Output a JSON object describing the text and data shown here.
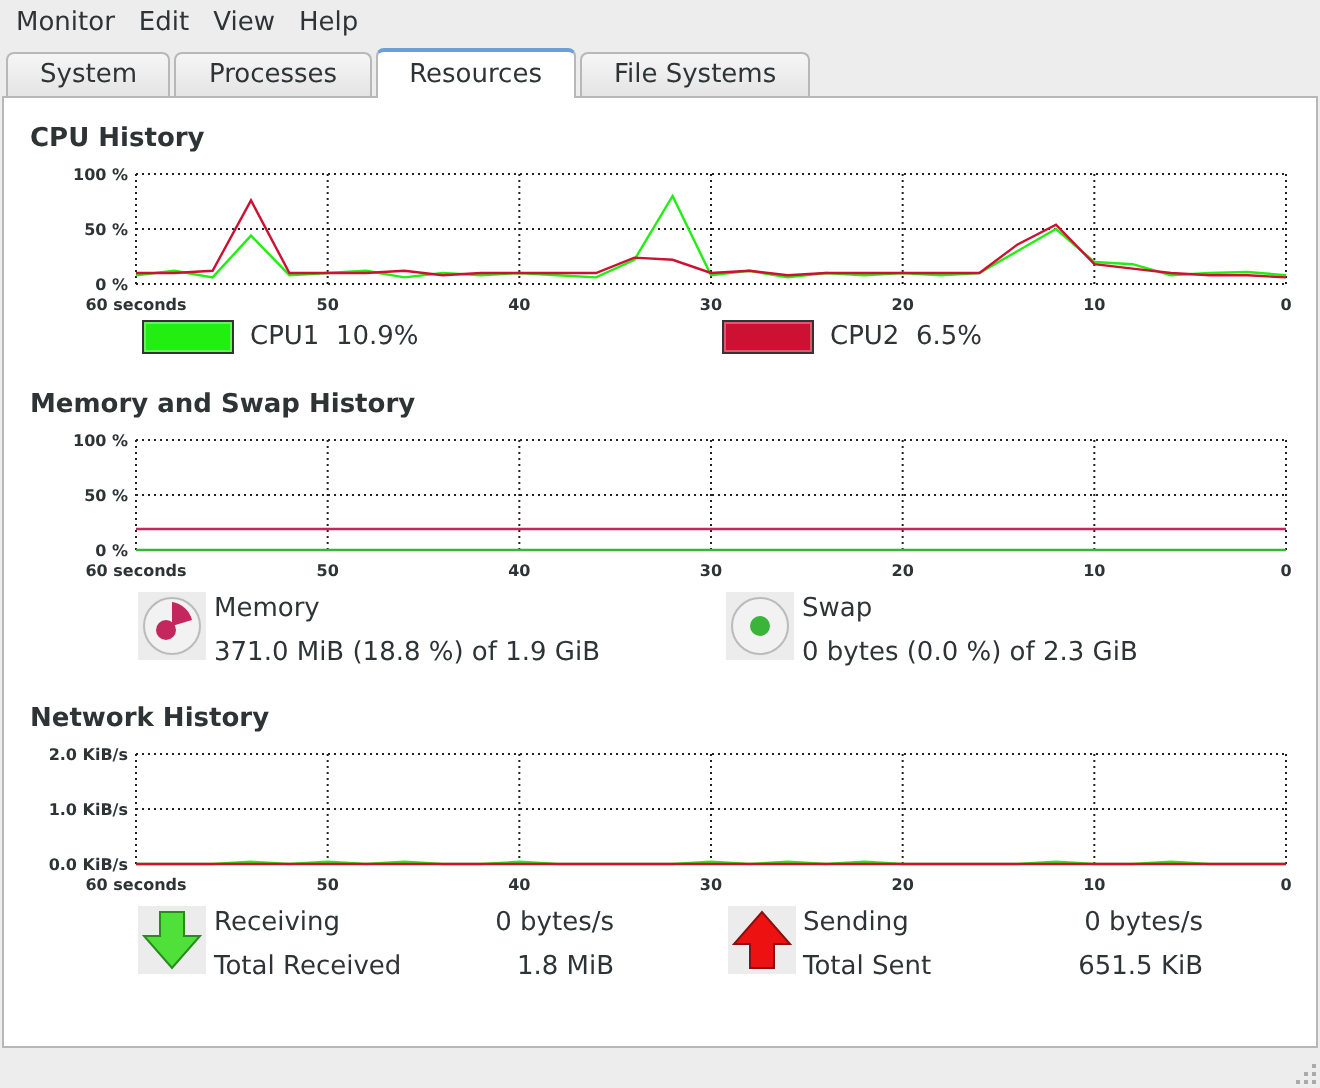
{
  "menu": [
    "Monitor",
    "Edit",
    "View",
    "Help"
  ],
  "tabs": [
    {
      "label": "System",
      "selected": false
    },
    {
      "label": "Processes",
      "selected": false
    },
    {
      "label": "Resources",
      "selected": true
    },
    {
      "label": "File Systems",
      "selected": false
    }
  ],
  "cpu_history": {
    "title": "CPU History",
    "chart_data": {
      "type": "line",
      "grid": true,
      "x": [
        60,
        58,
        56,
        54,
        52,
        50,
        48,
        46,
        44,
        42,
        40,
        38,
        36,
        34,
        32,
        30,
        28,
        26,
        24,
        22,
        20,
        18,
        16,
        14,
        12,
        10,
        8,
        6,
        4,
        2,
        0
      ],
      "xlim": [
        60,
        0
      ],
      "ylim": [
        0,
        100
      ],
      "xticks": [
        {
          "value": 60,
          "label": "60 seconds"
        },
        {
          "value": 50,
          "label": "50"
        },
        {
          "value": 40,
          "label": "40"
        },
        {
          "value": 30,
          "label": "30"
        },
        {
          "value": 20,
          "label": "20"
        },
        {
          "value": 10,
          "label": "10"
        },
        {
          "value": 0,
          "label": "0"
        }
      ],
      "yticks": [
        {
          "value": 100,
          "label": "100 %"
        },
        {
          "value": 50,
          "label": "50 %"
        },
        {
          "value": 0,
          "label": "0 %"
        }
      ],
      "series": [
        {
          "color": "#22ee11",
          "values": [
            8,
            12,
            6,
            44,
            8,
            10,
            12,
            6,
            10,
            8,
            10,
            8,
            6,
            22,
            80,
            8,
            12,
            6,
            10,
            8,
            10,
            8,
            10,
            30,
            50,
            20,
            18,
            8,
            10,
            11,
            8
          ]
        },
        {
          "color": "#cc1133",
          "values": [
            10,
            10,
            12,
            76,
            10,
            10,
            10,
            12,
            8,
            10,
            10,
            10,
            10,
            24,
            22,
            10,
            12,
            8,
            10,
            10,
            10,
            10,
            10,
            36,
            54,
            18,
            14,
            10,
            8,
            8,
            6
          ]
        }
      ]
    },
    "legend": [
      {
        "label": "CPU1",
        "reading": "10.9%",
        "color": "#22ee11"
      },
      {
        "label": "CPU2",
        "reading": "6.5%",
        "color": "#cc1133"
      }
    ]
  },
  "memory_history": {
    "title": "Memory and Swap History",
    "chart_data": {
      "type": "line",
      "grid": true,
      "x": [
        60,
        0
      ],
      "xlim": [
        60,
        0
      ],
      "ylim": [
        0,
        100
      ],
      "xticks": [
        {
          "value": 60,
          "label": "60 seconds"
        },
        {
          "value": 50,
          "label": "50"
        },
        {
          "value": 40,
          "label": "40"
        },
        {
          "value": 30,
          "label": "30"
        },
        {
          "value": 20,
          "label": "20"
        },
        {
          "value": 10,
          "label": "10"
        },
        {
          "value": 0,
          "label": "0"
        }
      ],
      "yticks": [
        {
          "value": 100,
          "label": "100 %"
        },
        {
          "value": 50,
          "label": "50 %"
        },
        {
          "value": 0,
          "label": "0 %"
        }
      ],
      "series": [
        {
          "color": "#c4265e",
          "values": [
            19,
            19
          ]
        },
        {
          "color": "#3ab53a",
          "values": [
            0,
            0
          ]
        }
      ]
    },
    "items": [
      {
        "kind": "memory",
        "label": "Memory",
        "detail": "371.0 MiB (18.8 %) of 1.9 GiB",
        "color": "#c4265e"
      },
      {
        "kind": "swap",
        "label": "Swap",
        "detail": "0 bytes (0.0 %) of 2.3 GiB",
        "color": "#3ab53a"
      }
    ]
  },
  "network_history": {
    "title": "Network History",
    "chart_data": {
      "type": "line",
      "grid": true,
      "x": [
        60,
        58,
        56,
        54,
        52,
        50,
        48,
        46,
        44,
        42,
        40,
        38,
        36,
        34,
        32,
        30,
        28,
        26,
        24,
        22,
        20,
        18,
        16,
        14,
        12,
        10,
        8,
        6,
        4,
        2,
        0
      ],
      "xlim": [
        60,
        0
      ],
      "ylim": [
        0,
        2
      ],
      "xticks": [
        {
          "value": 60,
          "label": "60 seconds"
        },
        {
          "value": 50,
          "label": "50"
        },
        {
          "value": 40,
          "label": "40"
        },
        {
          "value": 30,
          "label": "30"
        },
        {
          "value": 20,
          "label": "20"
        },
        {
          "value": 10,
          "label": "10"
        },
        {
          "value": 0,
          "label": "0"
        }
      ],
      "yticks": [
        {
          "value": 2,
          "label": "2.0 KiB/s"
        },
        {
          "value": 1,
          "label": "1.0 KiB/s"
        },
        {
          "value": 0,
          "label": "0.0 KiB/s"
        }
      ],
      "series": [
        {
          "color": "#22ee11",
          "values": [
            0,
            0,
            0,
            0.04,
            0,
            0.04,
            0,
            0.04,
            0,
            0,
            0.04,
            0,
            0,
            0,
            0,
            0.04,
            0,
            0.04,
            0,
            0.04,
            0,
            0,
            0,
            0,
            0.04,
            0,
            0,
            0.04,
            0,
            0,
            0
          ]
        },
        {
          "color": "#cc1133",
          "values": [
            0,
            0,
            0,
            0,
            0,
            0,
            0,
            0,
            0,
            0,
            0,
            0,
            0,
            0,
            0,
            0,
            0,
            0,
            0,
            0,
            0,
            0,
            0,
            0,
            0,
            0,
            0,
            0,
            0,
            0,
            0
          ]
        }
      ]
    },
    "items": [
      {
        "kind": "receiving",
        "rows": [
          {
            "label": "Receiving",
            "value": "0 bytes/s"
          },
          {
            "label": "Total Received",
            "value": "1.8 MiB"
          }
        ]
      },
      {
        "kind": "sending",
        "rows": [
          {
            "label": "Sending",
            "value": "0 bytes/s"
          },
          {
            "label": "Total Sent",
            "value": "651.5 KiB"
          }
        ]
      }
    ]
  }
}
